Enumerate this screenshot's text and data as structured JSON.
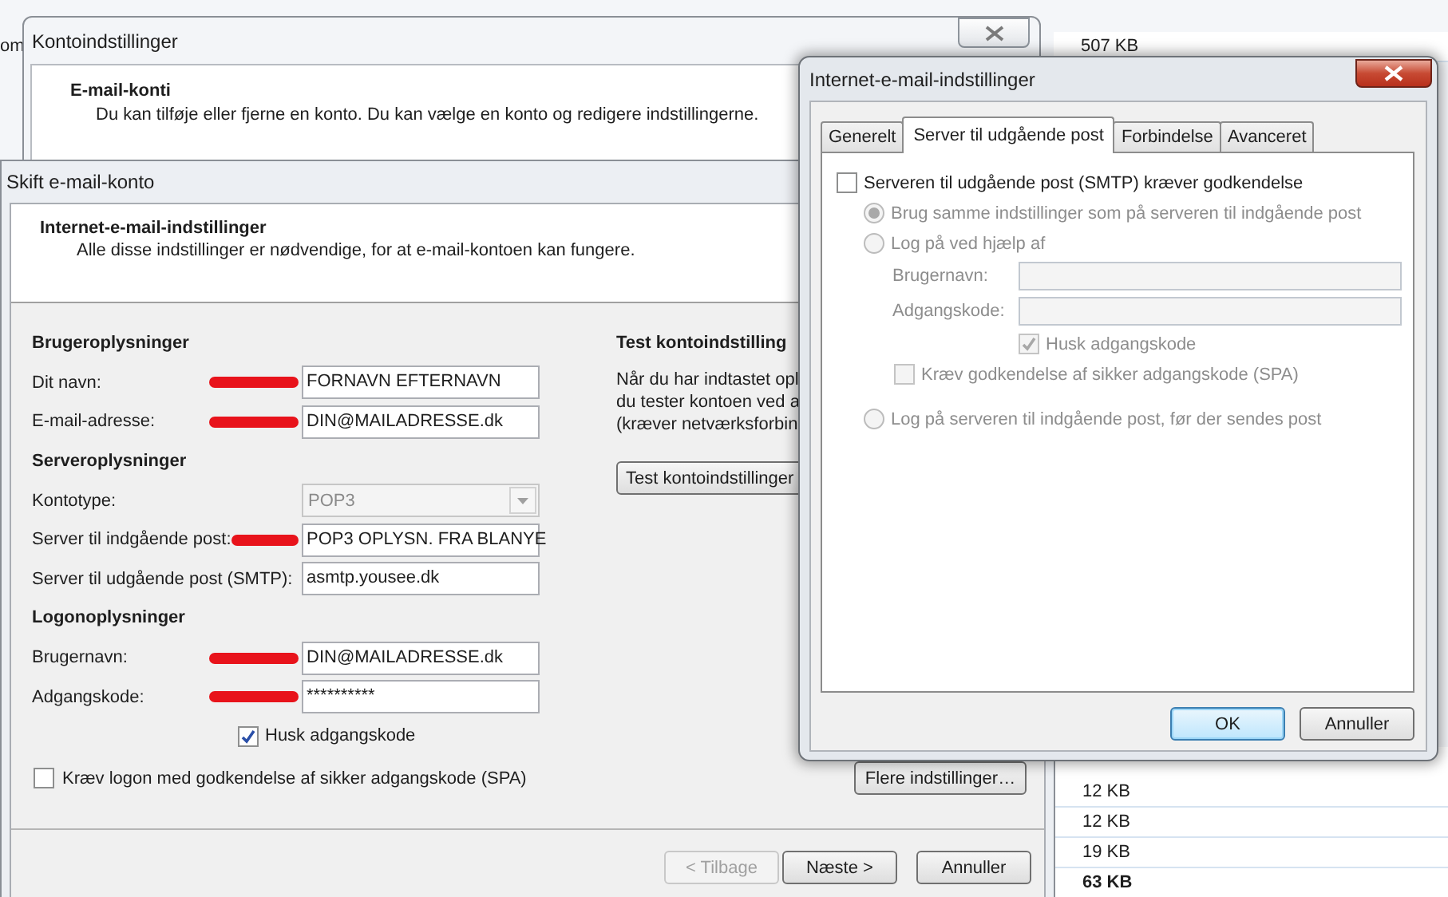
{
  "background_list": {
    "cut_text": "om",
    "top_sizes": [
      {
        "text": "507 KB",
        "bold": false
      }
    ],
    "bottom_sizes": [
      {
        "text": "12 KB",
        "bold": false
      },
      {
        "text": "12 KB",
        "bold": false
      },
      {
        "text": "19 KB",
        "bold": false
      },
      {
        "text": "63 KB",
        "bold": true
      }
    ]
  },
  "account_settings_window": {
    "title": "Kontoindstillinger",
    "heading": "E-mail-konti",
    "description": "Du kan tilføje eller fjerne en konto. Du kan vælge en konto og redigere indstillingerne."
  },
  "change_account_window": {
    "title": "Skift e-mail-konto",
    "heading": "Internet-e-mail-indstillinger",
    "description": "Alle disse indstillinger er nødvendige, for at e-mail-kontoen kan fungere.",
    "form": [
      {
        "kind": "heading",
        "text": "Brugeroplysninger"
      },
      {
        "kind": "field",
        "label": "Dit navn:",
        "value": "FORNAVN EFTERNAVN",
        "marked": true,
        "disabled": false
      },
      {
        "kind": "field",
        "label": "E-mail-adresse:",
        "value": "DIN@MAILADRESSE.dk",
        "marked": true,
        "disabled": false
      },
      {
        "kind": "heading",
        "text": "Serveroplysninger"
      },
      {
        "kind": "dropdown",
        "label": "Kontotype:",
        "value": "POP3",
        "marked": false,
        "disabled": true
      },
      {
        "kind": "field",
        "label": "Server til indgående post:",
        "value": "POP3 OPLYSN. FRA BLANYE",
        "marked": true,
        "disabled": false
      },
      {
        "kind": "field",
        "label": "Server til udgående post (SMTP):",
        "value": "asmtp.yousee.dk",
        "marked": false,
        "disabled": false
      },
      {
        "kind": "heading",
        "text": "Logonoplysninger"
      },
      {
        "kind": "field",
        "label": "Brugernavn:",
        "value": "DIN@MAILADRESSE.dk",
        "marked": true,
        "disabled": false
      },
      {
        "kind": "field",
        "label": "Adgangskode:",
        "value": "**********",
        "marked": true,
        "disabled": false
      },
      {
        "kind": "checkbox",
        "label": "Husk adgangskode",
        "checked": true,
        "indented": true
      },
      {
        "kind": "checkbox",
        "label": "Kræv logon med godkendelse af sikker adgangskode (SPA)",
        "checked": false,
        "indented": false
      }
    ],
    "test": {
      "heading": "Test kontoindstilling",
      "lines": [
        "Når du har indtastet opl",
        "du tester kontoen ved a",
        "(kræver netværksforbin"
      ],
      "button": "Test kontoindstillinger"
    },
    "more_button": "Flere indstillinger…",
    "buttons": [
      {
        "label": "< Tilbage",
        "disabled": true
      },
      {
        "label": "Næste >",
        "disabled": false
      },
      {
        "label": "Annuller",
        "disabled": false
      }
    ]
  },
  "internet_settings_window": {
    "title": "Internet-e-mail-indstillinger",
    "tabs": [
      {
        "label": "Generelt",
        "selected": false
      },
      {
        "label": "Server til udgående post",
        "selected": true
      },
      {
        "label": "Forbindelse",
        "selected": false
      },
      {
        "label": "Avanceret",
        "selected": false
      }
    ],
    "options": [
      {
        "kind": "checkbox",
        "label": "Serveren til udgående post (SMTP) kræver godkendelse",
        "checked": false,
        "disabled": false,
        "indented": false
      },
      {
        "kind": "radio",
        "label": "Brug samme indstillinger som på serveren til indgående post",
        "selected": true,
        "disabled": true
      },
      {
        "kind": "radio",
        "label": "Log på ved hjælp af",
        "selected": false,
        "disabled": true
      },
      {
        "kind": "field",
        "label": "Brugernavn:",
        "disabled": true
      },
      {
        "kind": "field",
        "label": "Adgangskode:",
        "disabled": true
      },
      {
        "kind": "checkbox",
        "label": "Husk adgangskode",
        "checked": true,
        "disabled": true,
        "indented": true
      },
      {
        "kind": "checkbox",
        "label": "Kræv godkendelse af sikker adgangskode (SPA)",
        "checked": false,
        "disabled": true,
        "indented": false
      },
      {
        "kind": "radio",
        "label": "Log på serveren til indgående post, før der sendes post",
        "selected": false,
        "disabled": true
      }
    ],
    "buttons": [
      {
        "label": "OK",
        "default": true
      },
      {
        "label": "Annuller",
        "default": false
      }
    ]
  }
}
